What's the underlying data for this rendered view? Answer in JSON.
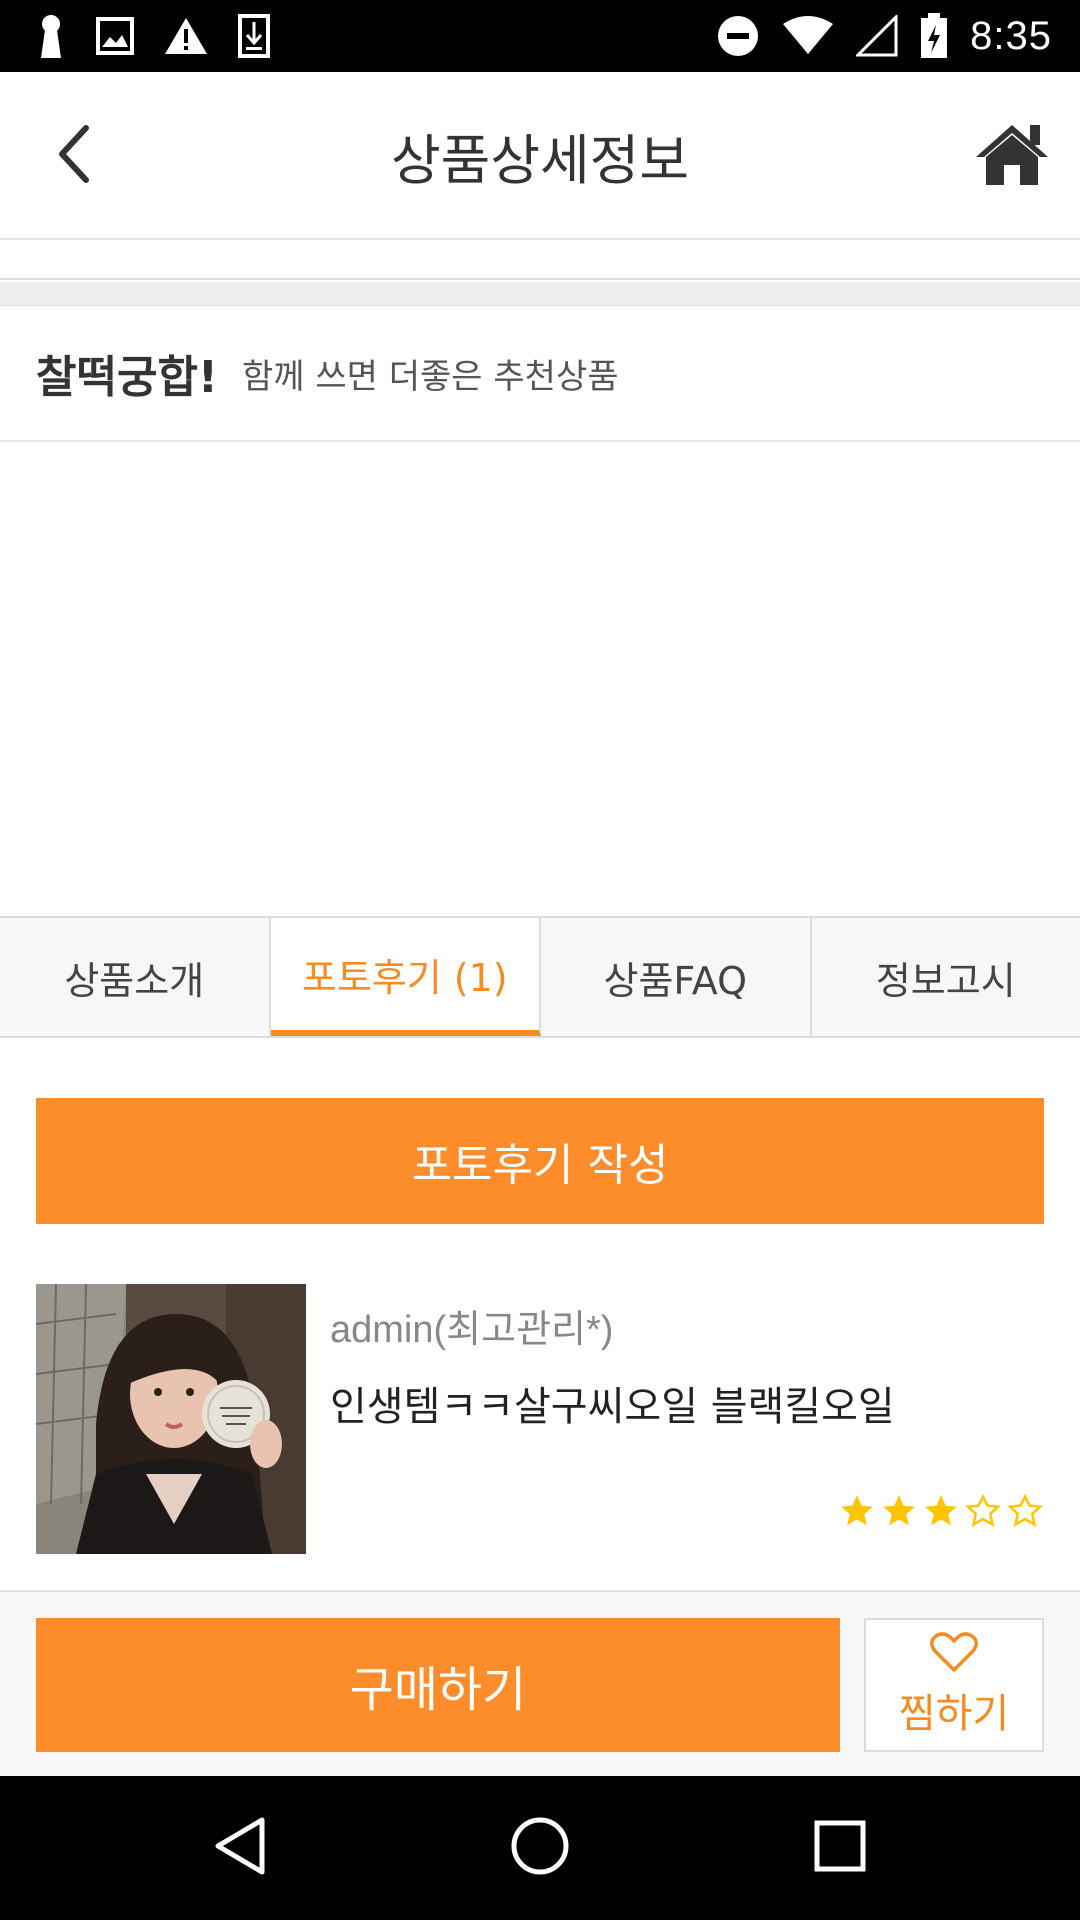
{
  "status_bar": {
    "time": "8:35",
    "icons": [
      "keyhole-icon",
      "image-icon",
      "warning-icon",
      "download-icon",
      "do-not-disturb-icon",
      "wifi-icon",
      "signal-icon",
      "battery-icon"
    ]
  },
  "header": {
    "title": "상품상세정보",
    "back_icon": "chevron-left-icon",
    "home_icon": "home-icon"
  },
  "recommend": {
    "title": "찰떡궁합!",
    "description": "함께 쓰면 더좋은 추천상품"
  },
  "tabs": [
    {
      "label": "상품소개",
      "active": false
    },
    {
      "label": "포토후기 (1)",
      "active": true
    },
    {
      "label": "상품FAQ",
      "active": false
    },
    {
      "label": "정보고시",
      "active": false
    }
  ],
  "write_review": {
    "label": "포토후기 작성"
  },
  "review": {
    "author": "admin(최고관리*)",
    "text": "인생템ㅋㅋ살구씨오일 블랙킬오일",
    "rating": 3,
    "rating_max": 5
  },
  "action_bar": {
    "buy_label": "구매하기",
    "wish_label": "찜하기"
  },
  "colors": {
    "accent": "#fd8d2a",
    "accent_text": "#f68b1f",
    "star": "#ffc400"
  }
}
